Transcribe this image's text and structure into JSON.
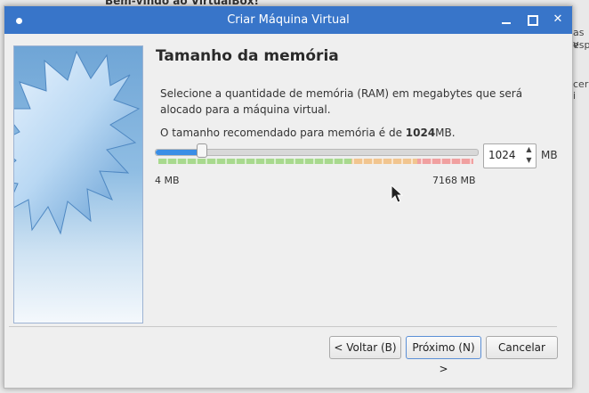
{
  "background": {
    "title": "Bem-vindo ao VirtualBox!",
    "text_fragments": [
      "as v",
      "espe",
      "cer i"
    ]
  },
  "window": {
    "title": "Criar Máquina Virtual",
    "controls": [
      "minimize-icon",
      "maximize-icon",
      "close-icon"
    ],
    "close_glyph": "✕"
  },
  "page": {
    "heading": "Tamanho da memória",
    "description": "Selecione a quantidade de memória (RAM) em megabytes que será alocado para a máquina virtual.",
    "recommend_prefix": "O tamanho recomendado para memória é de ",
    "recommend_value": "1024",
    "recommend_unit": "MB."
  },
  "memory": {
    "value": "1024",
    "min": 4,
    "max": 7168,
    "min_label": "4 MB",
    "max_label": "7168 MB",
    "unit": "MB",
    "zones": [
      {
        "name": "green",
        "from": 4,
        "to": 4400
      },
      {
        "name": "orange",
        "from": 4400,
        "to": 5900
      },
      {
        "name": "red",
        "from": 5900,
        "to": 7168
      }
    ]
  },
  "buttons": {
    "back": "< Voltar (B)",
    "next": "Próximo (N) >",
    "cancel": "Cancelar"
  },
  "colors": {
    "titlebar": "#3875c9",
    "slider_fill": "#3a8ee6",
    "zone_green": "#a8d98e",
    "zone_orange": "#f1c58f",
    "zone_red": "#f0a0a0"
  }
}
